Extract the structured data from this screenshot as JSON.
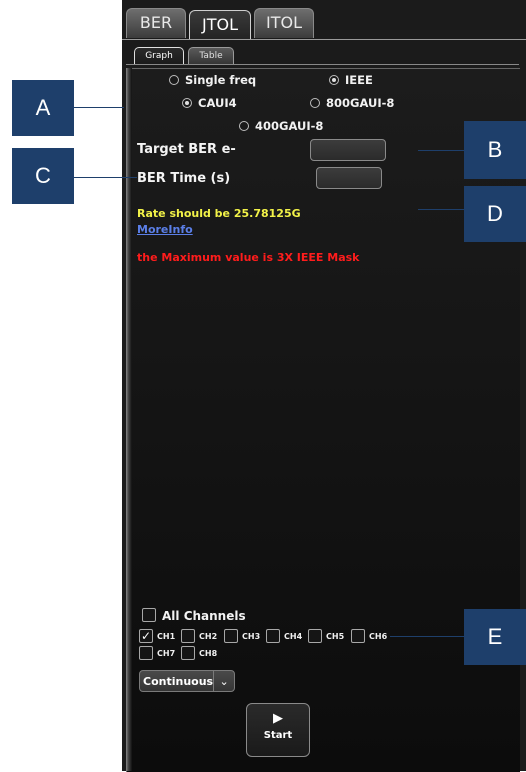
{
  "tabs": [
    {
      "label": "BER",
      "active": false
    },
    {
      "label": "JTOL",
      "active": true
    },
    {
      "label": "ITOL",
      "active": false
    }
  ],
  "subtabs": [
    {
      "label": "Graph",
      "active": true
    },
    {
      "label": "Table",
      "active": false
    }
  ],
  "mode_options": {
    "single_freq": {
      "label": "Single freq",
      "selected": false
    },
    "ieee": {
      "label": "IEEE",
      "selected": true
    }
  },
  "standards": {
    "caui4": {
      "label": "CAUI4",
      "selected": true
    },
    "gaui_800": {
      "label": "800GAUI-8",
      "selected": false
    },
    "gaui_400": {
      "label": "400GAUI-8",
      "selected": false
    }
  },
  "fields": {
    "target_ber_label": "Target BER e-",
    "target_ber_value": "",
    "ber_time_label": "BER Time (s)",
    "ber_time_value": ""
  },
  "messages": {
    "rate": "Rate should be 25.78125G",
    "more_info": "MoreInfo",
    "max_value": "the Maximum value is 3X IEEE Mask"
  },
  "channels": {
    "all_label": "All Channels",
    "all_checked": false,
    "items": [
      {
        "label": "CH1",
        "checked": true
      },
      {
        "label": "CH2",
        "checked": false
      },
      {
        "label": "CH3",
        "checked": false
      },
      {
        "label": "CH4",
        "checked": false
      },
      {
        "label": "CH5",
        "checked": false
      },
      {
        "label": "CH6",
        "checked": false
      },
      {
        "label": "CH7",
        "checked": false
      },
      {
        "label": "CH8",
        "checked": false
      }
    ]
  },
  "run_mode": {
    "selected": "Continuous",
    "chevron_icon": "chevron-down-icon"
  },
  "start": {
    "label": "Start",
    "icon": "play-icon"
  },
  "callouts": {
    "a": "A",
    "b": "B",
    "c": "C",
    "d": "D",
    "e": "E"
  },
  "colors": {
    "callout_bg": "#1e3f6b",
    "rate_text": "#f2f248",
    "link_text": "#5b7fe8",
    "warning_text": "#ff1c1c"
  }
}
